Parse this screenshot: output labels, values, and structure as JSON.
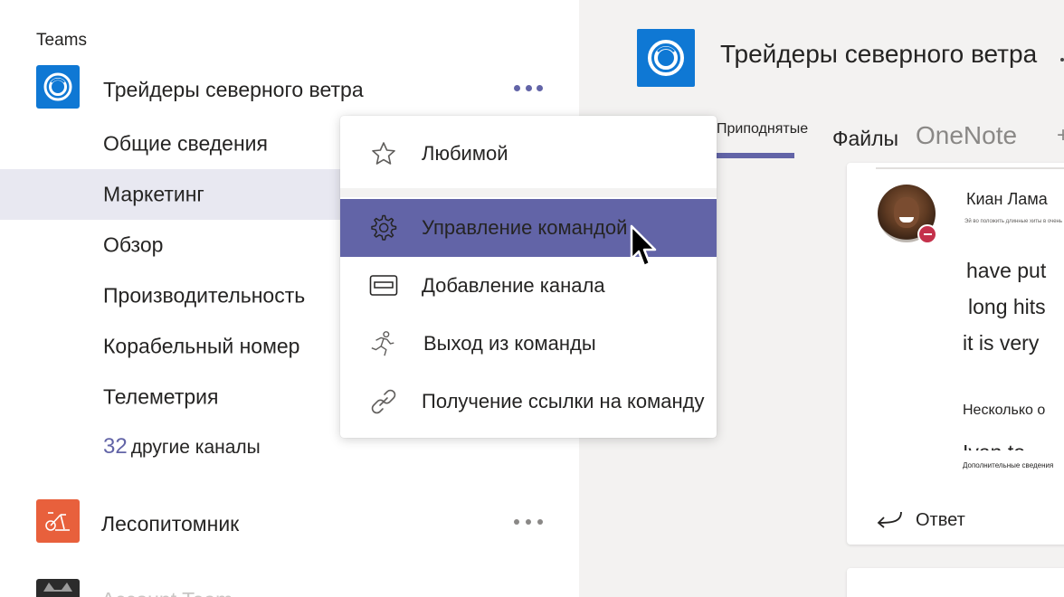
{
  "sidebar": {
    "header": "Teams",
    "teams": [
      {
        "name": "Трейдеры северного ветра",
        "color": "#0f78d4",
        "icon": "concentric-rings-icon"
      },
      {
        "name": "Лесопитомник",
        "color": "#e8603c",
        "icon": "exercise-bike-icon"
      },
      {
        "name": "Account Team",
        "color": "#2b2b2b",
        "icon": "cat-avatar-icon"
      }
    ],
    "channels": [
      {
        "label": "Общие сведения"
      },
      {
        "label": "Маркетинг",
        "active": true
      },
      {
        "label": "Обзор"
      },
      {
        "label": "Производительность"
      },
      {
        "label": "Корабельный номер"
      },
      {
        "label": "Телеметрия"
      }
    ],
    "more_channels": {
      "count": "32",
      "label": "другие каналы"
    }
  },
  "header": {
    "team_title": "Трейдеры северного ветра",
    "tabs": [
      {
        "label": "Приподнятые",
        "active": true
      },
      {
        "label": "Файлы"
      },
      {
        "label": "OneNote"
      },
      {
        "label": "+"
      }
    ]
  },
  "message": {
    "sender": "Киан Лама",
    "subtitle": "Эй во положить длинные хиты в очень",
    "lines": [
      "have put",
      "long hits",
      "it is very"
    ],
    "small_line": "Несколько о",
    "clipped_line": "Ivan to",
    "more_details": "Дополнительные сведения",
    "reply_label": "Ответ",
    "status": "do-not-disturb"
  },
  "menu": {
    "items": [
      {
        "label": "Любимой",
        "icon": "star-icon"
      },
      {
        "label": "Управление командой",
        "icon": "gear-icon",
        "highlighted": true
      },
      {
        "label": "Добавление канала",
        "icon": "channel-card-icon"
      },
      {
        "label": "Выход из команды",
        "icon": "running-person-icon"
      },
      {
        "label": "Получение ссылки на команду",
        "icon": "link-icon"
      }
    ]
  },
  "colors": {
    "accent": "#6264a7",
    "active_channel_bg": "#e8e8f1",
    "team_blue": "#0f78d4",
    "team_orange": "#e8603c",
    "status_red": "#c4314b"
  }
}
